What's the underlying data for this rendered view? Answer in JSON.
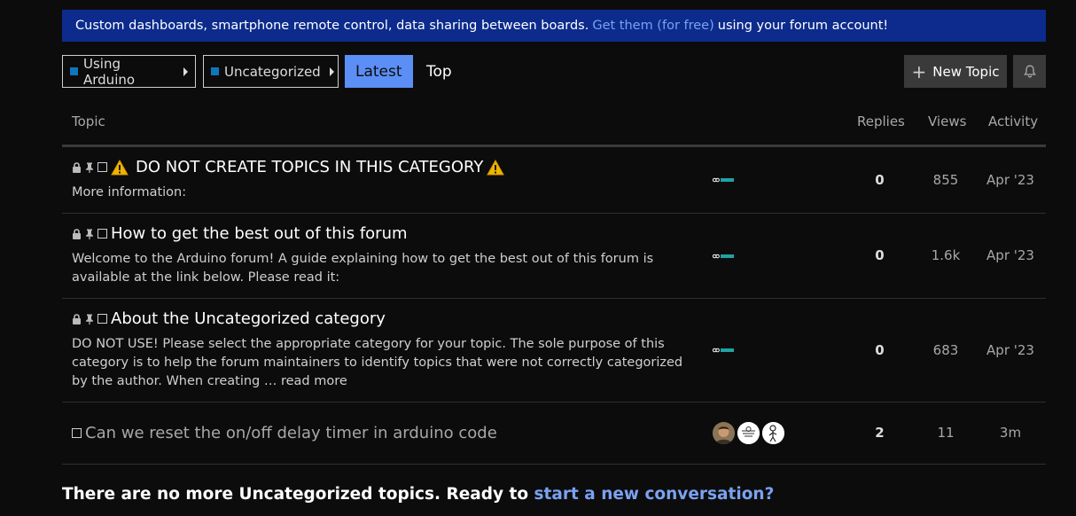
{
  "banner": {
    "text_before": "Custom dashboards, smartphone remote control, data sharing between boards.",
    "link_text": "Get them (for free)",
    "text_after": "using your forum account!"
  },
  "nav": {
    "category": "Using Arduino",
    "subcategory": "Uncategorized",
    "tabs": [
      "Latest",
      "Top"
    ],
    "active_tab": "Latest",
    "new_topic_label": "New Topic"
  },
  "table_headers": {
    "topic": "Topic",
    "replies": "Replies",
    "views": "Views",
    "activity": "Activity"
  },
  "topics": [
    {
      "title": "DO NOT CREATE TOPICS IN THIS CATEGORY",
      "locked": true,
      "pinned": true,
      "excerpt": "More information:",
      "replies": "0",
      "views": "855",
      "activity": "Apr '23"
    },
    {
      "title": "How to get the best out of this forum",
      "locked": true,
      "pinned": true,
      "excerpt": "Welcome to the Arduino forum! A guide explaining how to get the best out of this forum is available at the link below. Please read it:",
      "replies": "0",
      "views": "1.6k",
      "activity": "Apr '23"
    },
    {
      "title": "About the Uncategorized category",
      "locked": true,
      "pinned": true,
      "excerpt": "DO NOT USE! Please select the appropriate category for your topic. The sole purpose of this category is to help the forum maintainers to identify topics that were not correctly categorized by the author. When creating …",
      "excerpt_more": "read more",
      "replies": "0",
      "views": "683",
      "activity": "Apr '23"
    },
    {
      "title": "Can we reset the on/off delay timer in arduino code",
      "locked": false,
      "pinned": false,
      "replies": "2",
      "views": "11",
      "activity": "3m"
    }
  ],
  "footer": {
    "text": "There are no more Uncategorized topics. Ready to",
    "link_text": "start a new conversation?"
  },
  "colors": {
    "background": "#0d0c0d",
    "banner": "#0c2b8c",
    "accent": "#5c8ff5",
    "link": "#7aa2f0",
    "category_square": "#0e76bd",
    "warning": "#f0b400"
  }
}
